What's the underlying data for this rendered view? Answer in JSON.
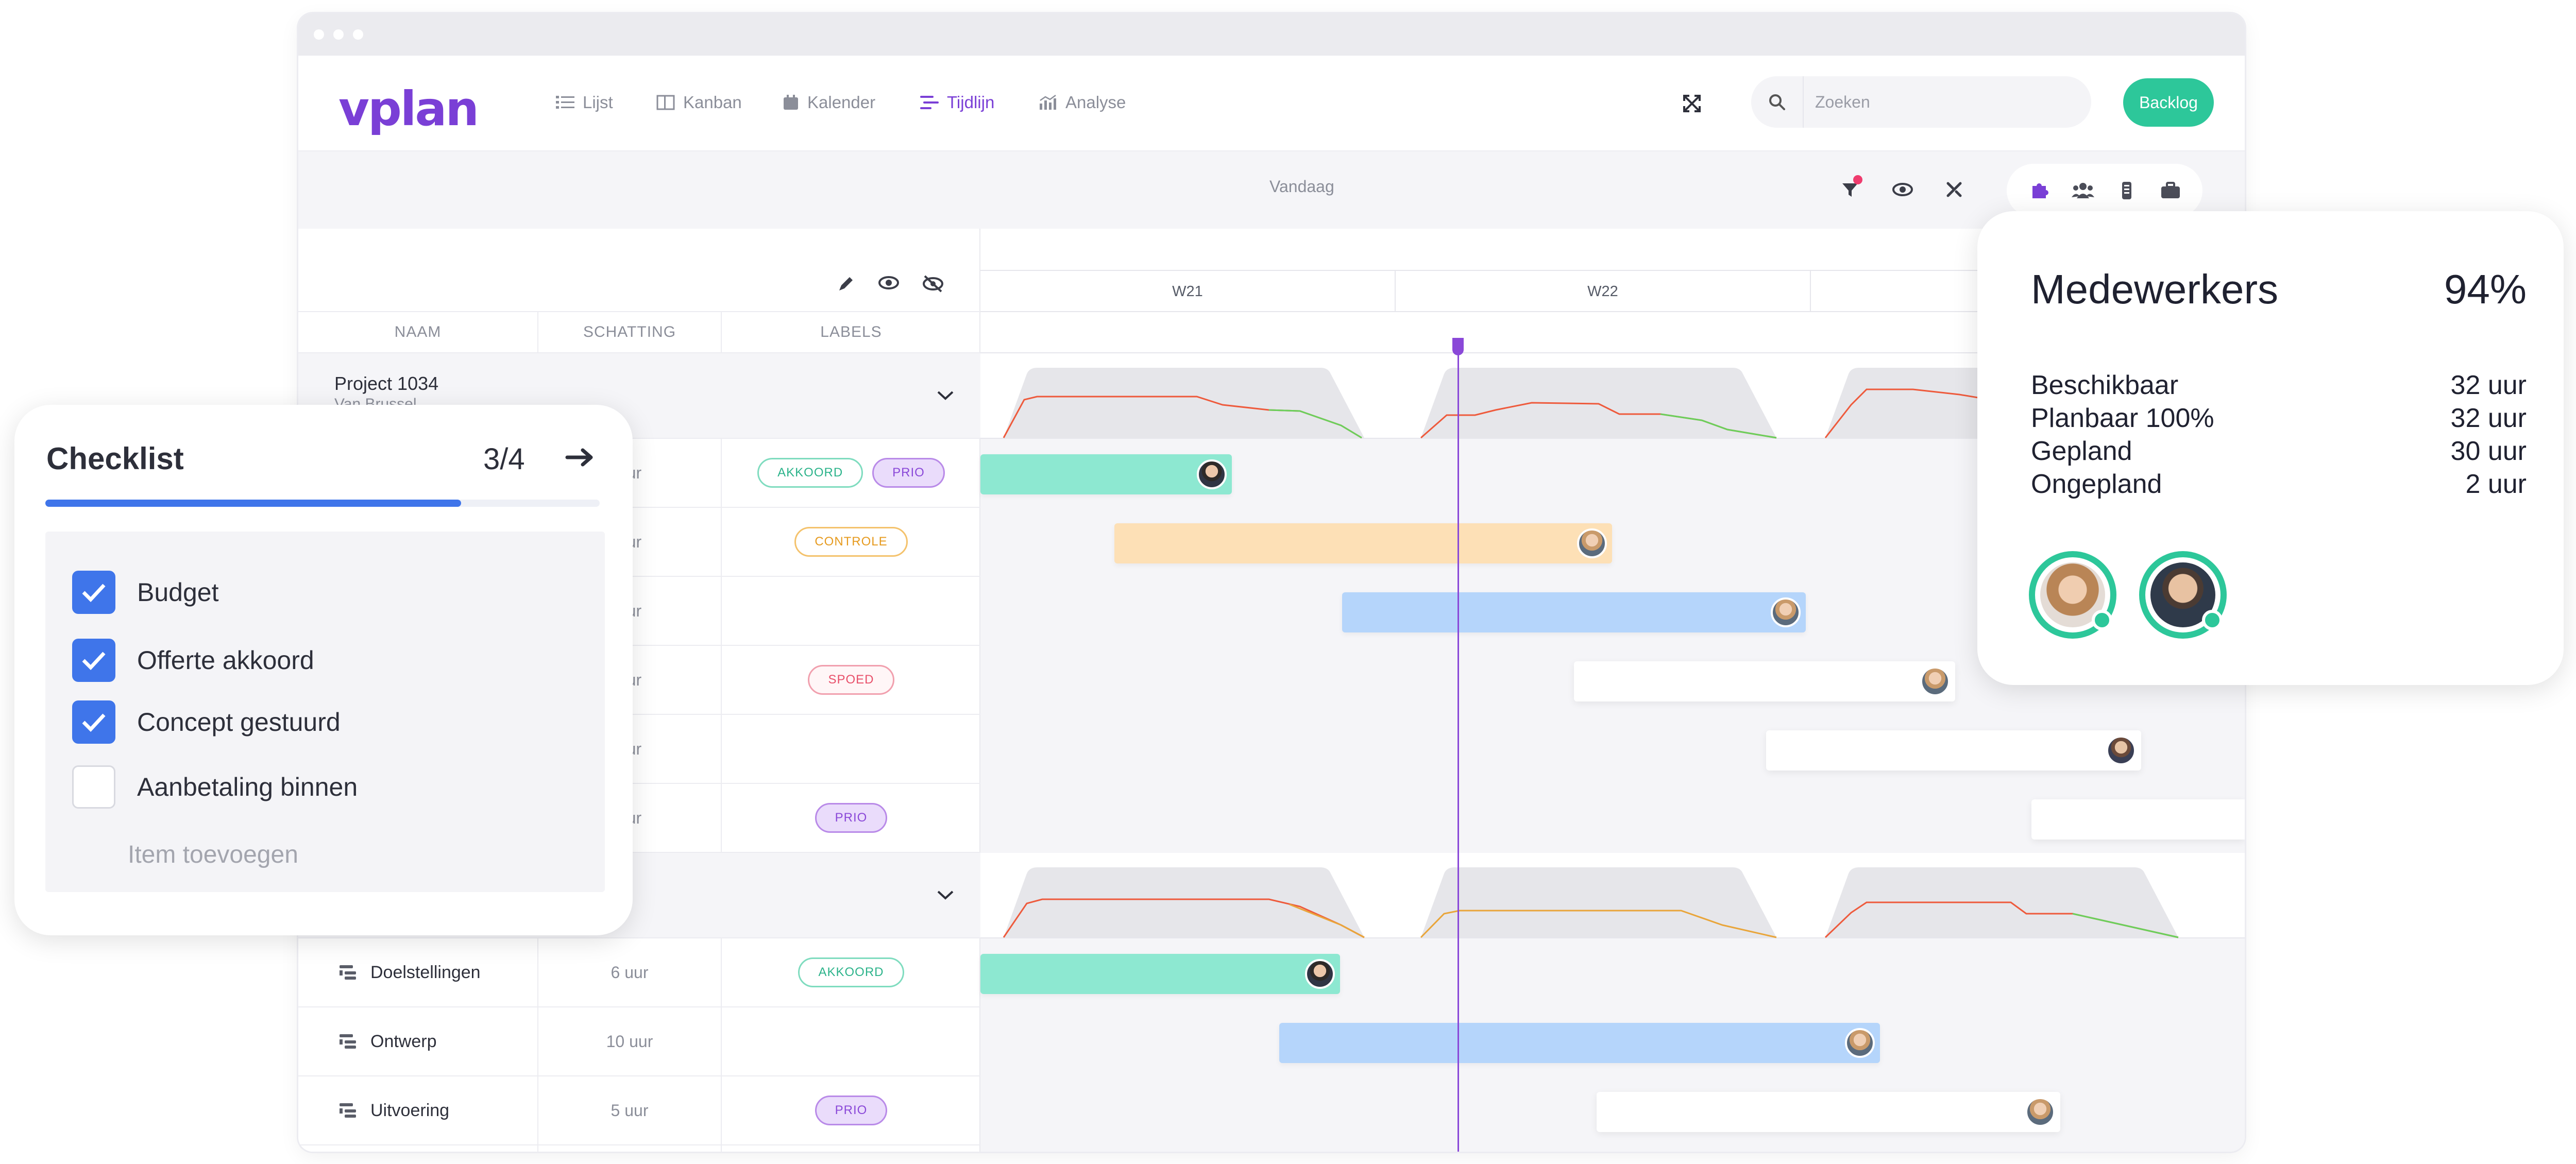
{
  "app": {
    "logo": "vplan"
  },
  "nav": {
    "items": [
      {
        "label": "Lijst",
        "icon": "list-icon"
      },
      {
        "label": "Kanban",
        "icon": "kanban-icon"
      },
      {
        "label": "Kalender",
        "icon": "calendar-icon"
      },
      {
        "label": "Tijdlijn",
        "icon": "timeline-icon",
        "active": true
      },
      {
        "label": "Analyse",
        "icon": "chart-icon"
      }
    ],
    "search_placeholder": "Zoeken",
    "backlog_label": "Backlog"
  },
  "toolbar": {
    "today_label": "Vandaag"
  },
  "table": {
    "columns": [
      "NAAM",
      "SCHATTING",
      "LABELS"
    ],
    "groups": [
      {
        "title": "Project 1034",
        "subtitle": "Van Brussel",
        "rows": [
          {
            "name": "",
            "estimate": "uur",
            "labels": [
              "AKKOORD",
              "PRIO"
            ]
          },
          {
            "name": "",
            "estimate": "uur",
            "labels": [
              "CONTROLE"
            ]
          },
          {
            "name": "",
            "estimate": "uur",
            "labels": []
          },
          {
            "name": "",
            "estimate": "uur",
            "labels": [
              "SPOED"
            ]
          },
          {
            "name": "",
            "estimate": "uur",
            "labels": []
          },
          {
            "name": "",
            "estimate": "uur",
            "labels": [
              "PRIO"
            ]
          }
        ]
      },
      {
        "title": "",
        "subtitle": "",
        "rows": [
          {
            "name": "Doelstellingen",
            "estimate": "6 uur",
            "labels": [
              "AKKOORD"
            ]
          },
          {
            "name": "Ontwerp",
            "estimate": "10 uur",
            "labels": []
          },
          {
            "name": "Uitvoering",
            "estimate": "5 uur",
            "labels": [
              "PRIO"
            ]
          }
        ]
      }
    ]
  },
  "timeline": {
    "weeks": [
      "W21",
      "W22"
    ]
  },
  "checklist": {
    "title": "Checklist",
    "count": "3/4",
    "progress": 0.75,
    "items": [
      {
        "label": "Budget",
        "checked": true
      },
      {
        "label": "Offerte akkoord",
        "checked": true
      },
      {
        "label": "Concept gestuurd",
        "checked": true
      },
      {
        "label": "Aanbetaling binnen",
        "checked": false
      }
    ],
    "add_label": "Item toevoegen"
  },
  "medewerkers": {
    "title": "Medewerkers",
    "percent": "94%",
    "rows": [
      {
        "label": "Beschikbaar",
        "value": "32 uur"
      },
      {
        "label": "Planbaar 100%",
        "value": "32 uur"
      },
      {
        "label": "Gepland",
        "value": "30 uur"
      },
      {
        "label": "Ongepland",
        "value": "2 uur"
      }
    ]
  },
  "colors": {
    "brand": "#7a3fd6",
    "accent_green": "#2dc79a",
    "checkbox_blue": "#3f75ea"
  }
}
